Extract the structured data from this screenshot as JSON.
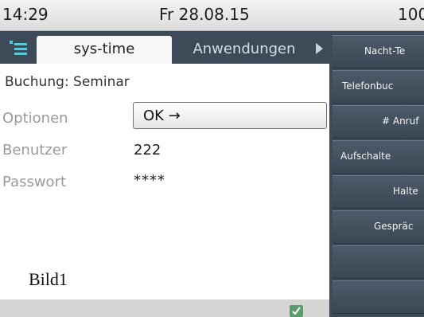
{
  "status_bar": {
    "time": "14:29",
    "date": "Fr 28.08.15",
    "number": "100"
  },
  "tabs": [
    {
      "label": "sys-time",
      "active": true
    },
    {
      "label": "Anwendungen",
      "active": false
    }
  ],
  "content": {
    "booking": "Buchung: Seminar",
    "fields": {
      "options": {
        "label": "Optionen",
        "value": "OK →"
      },
      "user": {
        "label": "Benutzer",
        "value": "222"
      },
      "password": {
        "label": "Passwort",
        "value": "****"
      }
    },
    "caption": "Bild1"
  },
  "softkeys": [
    {
      "label": "Nacht-Te"
    },
    {
      "label": "Telefonbuc"
    },
    {
      "label": "# Anruf"
    },
    {
      "label": "Aufschalte"
    },
    {
      "label": "Halte"
    },
    {
      "label": "Gespräc"
    },
    {
      "label": ""
    },
    {
      "label": ""
    }
  ],
  "icons": {
    "menu": "menu-icon",
    "tab_next": "arrow-right-icon",
    "confirm": "checkmark-icon"
  },
  "colors": {
    "accent": "#4ad0df",
    "panel": "#3d4a58",
    "confirm": "#5b9b6c"
  }
}
